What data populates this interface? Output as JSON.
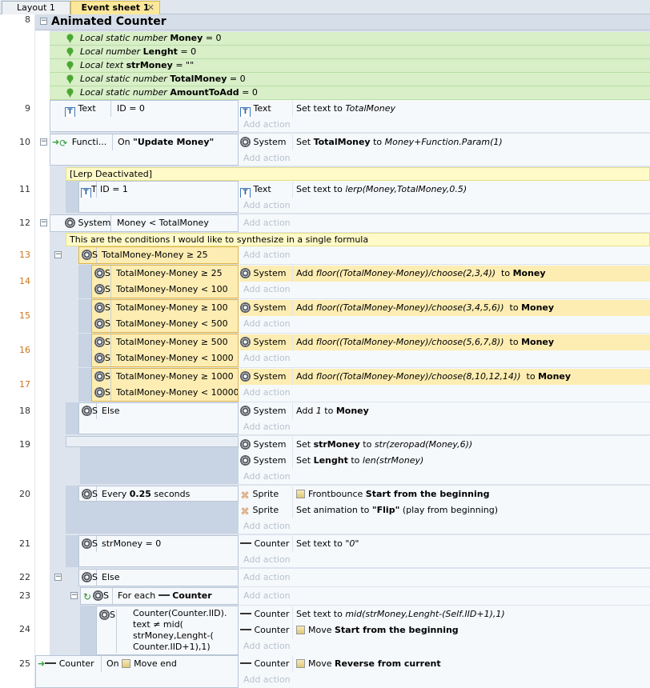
{
  "tabs": [
    {
      "label": "Layout 1"
    },
    {
      "label": "Event sheet 1",
      "close": "✕"
    }
  ],
  "group": {
    "row": "8",
    "title": "Animated Counter"
  },
  "variables": [
    {
      "kind": "Local static number",
      "name": "Money",
      "value": "= 0"
    },
    {
      "kind": "Local number",
      "name": "Lenght",
      "value": "= 0"
    },
    {
      "kind": "Local text",
      "name": "strMoney",
      "value": "= \"\""
    },
    {
      "kind": "Local static number",
      "name": "TotalMoney",
      "value": "= 0"
    },
    {
      "kind": "Local static number",
      "name": "AmountToAdd",
      "value": "= 0"
    }
  ],
  "rows": {
    "r9": "9",
    "r10": "10",
    "r11": "11",
    "r12": "12",
    "r13": "13",
    "r14": "14",
    "r15": "15",
    "r16": "16",
    "r17": "17",
    "r18": "18",
    "r19": "19",
    "r20": "20",
    "r21": "21",
    "r22": "22",
    "r23": "23",
    "r24": "24",
    "r25": "25"
  },
  "common": {
    "add_action": "Add action",
    "system": "System",
    "text": "Text",
    "sprite": "Sprite",
    "counter": "Counter",
    "to": "to",
    "s": "S",
    "t": "T"
  },
  "e9": {
    "cond": "ID = 0",
    "act_pre": "Set text to",
    "act_val": "TotalMoney"
  },
  "e10": {
    "obj": "Functi...",
    "cond_pre": "On",
    "cond_val": "\"Update Money\"",
    "act_pre": "Set",
    "act_var": "TotalMoney",
    "act_to": "to",
    "act_expr": "Money+Function.Param(1)"
  },
  "comment1": "[Lerp Deactivated]",
  "e11": {
    "cond": "ID = 1",
    "act_pre": "Set text to",
    "act_val": "lerp(Money,TotalMoney,0.5)"
  },
  "e12": {
    "cond": "Money < TotalMoney"
  },
  "comment2": "This are the conditions I would like to synthesize in a single formula",
  "e13": {
    "cond": "TotalMoney-Money ≥ 25"
  },
  "e14": {
    "c1": "TotalMoney-Money ≥ 25",
    "c2": "TotalMoney-Money < 100",
    "act_pre": "Add",
    "act_expr": "floor((TotalMoney-Money)/choose(2,3,4))",
    "act_to": "to",
    "act_var": "Money"
  },
  "e15": {
    "c1": "TotalMoney-Money ≥ 100",
    "c2": "TotalMoney-Money < 500",
    "act_pre": "Add",
    "act_expr": "floor((TotalMoney-Money)/choose(3,4,5,6))",
    "act_to": "to",
    "act_var": "Money"
  },
  "e16": {
    "c1": "TotalMoney-Money ≥ 500",
    "c2": "TotalMoney-Money < 1000",
    "act_pre": "Add",
    "act_expr": "floor((TotalMoney-Money)/choose(5,6,7,8))",
    "act_to": "to",
    "act_var": "Money"
  },
  "e17": {
    "c1": "TotalMoney-Money ≥ 1000",
    "c2": "TotalMoney-Money < 10000",
    "act_pre": "Add",
    "act_expr": "floor((TotalMoney-Money)/choose(8,10,12,14))",
    "act_to": "to",
    "act_var": "Money"
  },
  "e18": {
    "cond": "Else",
    "act_pre": "Add",
    "act_num": "1",
    "act_to": "to",
    "act_var": "Money"
  },
  "e19": {
    "a1_pre": "Set",
    "a1_var": "strMoney",
    "a1_to": "to",
    "a1_expr": "str(zeropad(Money,6))",
    "a2_pre": "Set",
    "a2_var": "Lenght",
    "a2_to": "to",
    "a2_expr": "len(strMoney)"
  },
  "e20": {
    "cond_pre": "Every",
    "cond_val": "0.25",
    "cond_post": "seconds",
    "a1_obj": "Frontbounce",
    "a1_act": "Start from the beginning",
    "a2_pre": "Set animation to",
    "a2_val": "\"Flip\"",
    "a2_post": "(play from beginning)"
  },
  "e21": {
    "cond": "strMoney = 0",
    "act_pre": "Set text to",
    "act_val": "\"0\""
  },
  "e22": {
    "cond": "Else"
  },
  "e23": {
    "cond_pre": "For each",
    "cond_obj": "Counter"
  },
  "e24": {
    "cond_l1": "Counter(Counter.IID).",
    "cond_l2": "text ≠ mid(",
    "cond_l3": "strMoney,Lenght-(",
    "cond_l4": "Counter.IID+1),1)",
    "a1_pre": "Set text to",
    "a1_val": "mid(strMoney,Lenght-(Self.IID+1),1)",
    "a2_pre": "Move",
    "a2_val": "Start from the beginning"
  },
  "e25": {
    "cond_pre": "On",
    "cond_val": "Move end",
    "act_pre": "Move",
    "act_val": "Reverse from current"
  }
}
